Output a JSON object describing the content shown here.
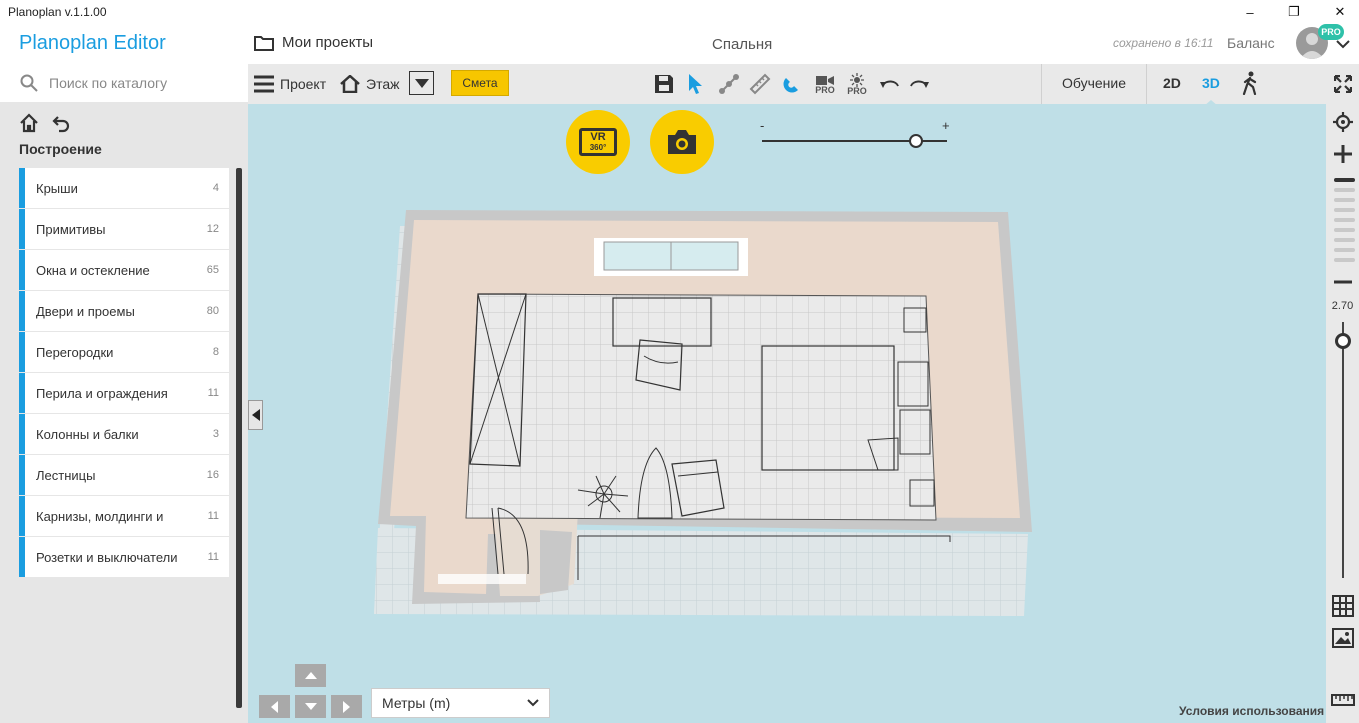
{
  "window": {
    "title": "Planoplan v.1.1.00",
    "minimize": "–",
    "restore": "❐",
    "close": "✕"
  },
  "header": {
    "brand": "Planoplan Editor",
    "projects_label": "Мои проекты",
    "room_name": "Спальня",
    "saved_status": "сохранено в 16:11",
    "balance_label": "Баланс",
    "pro_badge": "PRO"
  },
  "sidebar": {
    "search_placeholder": "Поиск по каталогу",
    "section_title": "Построение",
    "categories": [
      {
        "label": "Крыши",
        "count": "4"
      },
      {
        "label": "Примитивы",
        "count": "12"
      },
      {
        "label": "Окна и остекление",
        "count": "65"
      },
      {
        "label": "Двери и проемы",
        "count": "80"
      },
      {
        "label": "Перегородки",
        "count": "8"
      },
      {
        "label": "Перила и ограждения",
        "count": "11"
      },
      {
        "label": "Колонны и балки",
        "count": "3"
      },
      {
        "label": "Лестницы",
        "count": "16"
      },
      {
        "label": "Карнизы, молдинги и",
        "count": "11"
      },
      {
        "label": "Розетки и выключатели",
        "count": "11"
      }
    ]
  },
  "toolbar": {
    "project_label": "Проект",
    "floor_label": "Этаж",
    "estimate_label": "Смета",
    "pro_label_1": "PRO",
    "pro_label_2": "PRO",
    "learn_label": "Обучение",
    "view_2d": "2D",
    "view_3d": "3D",
    "accent_color": "#1a9de0",
    "estimate_color": "#f7c600"
  },
  "viewport": {
    "vr_label": "VR",
    "vr_sub": "360°",
    "zoom_minus": "-",
    "zoom_plus": "+",
    "zoom_level": 0.83,
    "units_value": "Метры (m)",
    "terms_label": "Условия использования"
  },
  "right_panel": {
    "height_value": "2.70",
    "height_slider_level": 0.95
  }
}
